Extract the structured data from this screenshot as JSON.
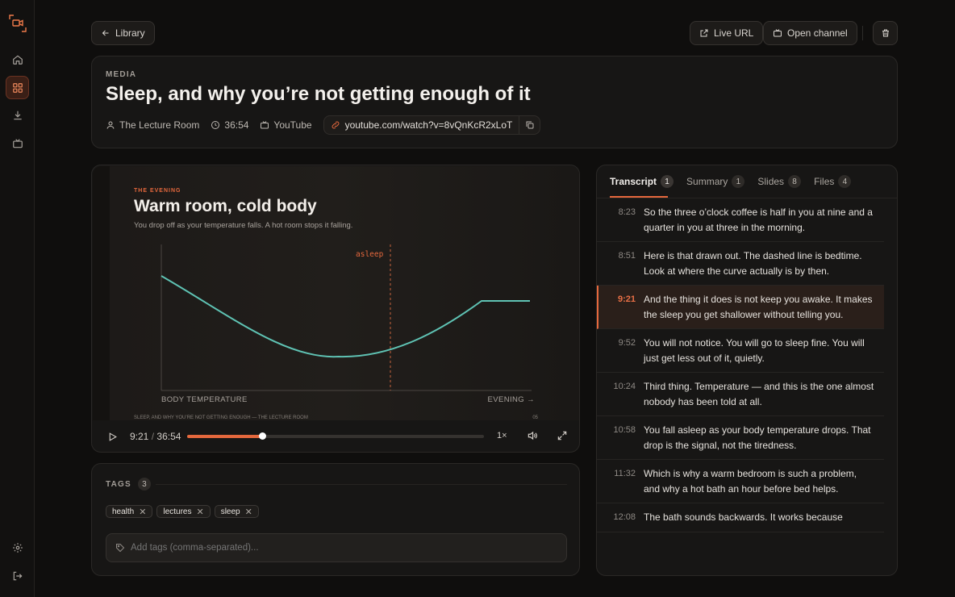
{
  "nav": {
    "back_label": "Library",
    "live_url_label": "Live URL",
    "open_channel_label": "Open channel"
  },
  "media": {
    "eyebrow": "MEDIA",
    "title": "Sleep, and why you’re not getting enough of it",
    "author": "The Lecture Room",
    "duration": "36:54",
    "platform": "YouTube",
    "url": "youtube.com/watch?v=8vQnKcR2xLoT"
  },
  "slide": {
    "kicker": "THE EVENING",
    "heading": "Warm room, cold body",
    "subtitle": "You drop off as your temperature falls. A hot room stops it falling.",
    "marker_label": "asleep",
    "y_label": "BODY TEMPERATURE",
    "x_label": "EVENING →",
    "footer_left": "SLEEP, AND WHY YOU’RE NOT GETTING ENOUGH — THE LECTURE ROOM",
    "footer_right": "05"
  },
  "player": {
    "current_time": "9:21",
    "separator": "/",
    "total_time": "36:54",
    "speed": "1×",
    "progress": 0.254
  },
  "tags": {
    "label": "TAGS",
    "count": "3",
    "items": [
      "health",
      "lectures",
      "sleep"
    ],
    "placeholder": "Add tags (comma-separated)..."
  },
  "panel": {
    "tabs": [
      {
        "label": "Transcript",
        "count": "1"
      },
      {
        "label": "Summary",
        "count": "1"
      },
      {
        "label": "Slides",
        "count": "8"
      },
      {
        "label": "Files",
        "count": "4"
      }
    ]
  },
  "transcript": [
    {
      "time": "8:23",
      "text": "So the three o’clock coffee is half in you at nine and a quarter in you at three in the morning."
    },
    {
      "time": "8:51",
      "text": "Here is that drawn out. The dashed line is bedtime. Look at where the curve actually is by then."
    },
    {
      "time": "9:21",
      "text": "And the thing it does is not keep you awake. It makes the sleep you get shallower without telling you."
    },
    {
      "time": "9:52",
      "text": "You will not notice. You will go to sleep fine. You will just get less out of it, quietly."
    },
    {
      "time": "10:24",
      "text": "Third thing. Temperature — and this is the one almost nobody has been told at all."
    },
    {
      "time": "10:58",
      "text": "You fall asleep as your body temperature drops. That drop is the signal, not the tiredness."
    },
    {
      "time": "11:32",
      "text": "Which is why a warm bedroom is such a problem, and why a hot bath an hour before bed helps."
    },
    {
      "time": "12:08",
      "text": "The bath sounds backwards. It works because"
    }
  ],
  "colors": {
    "accent": "#e5683d",
    "curve": "#5fc3b4"
  }
}
